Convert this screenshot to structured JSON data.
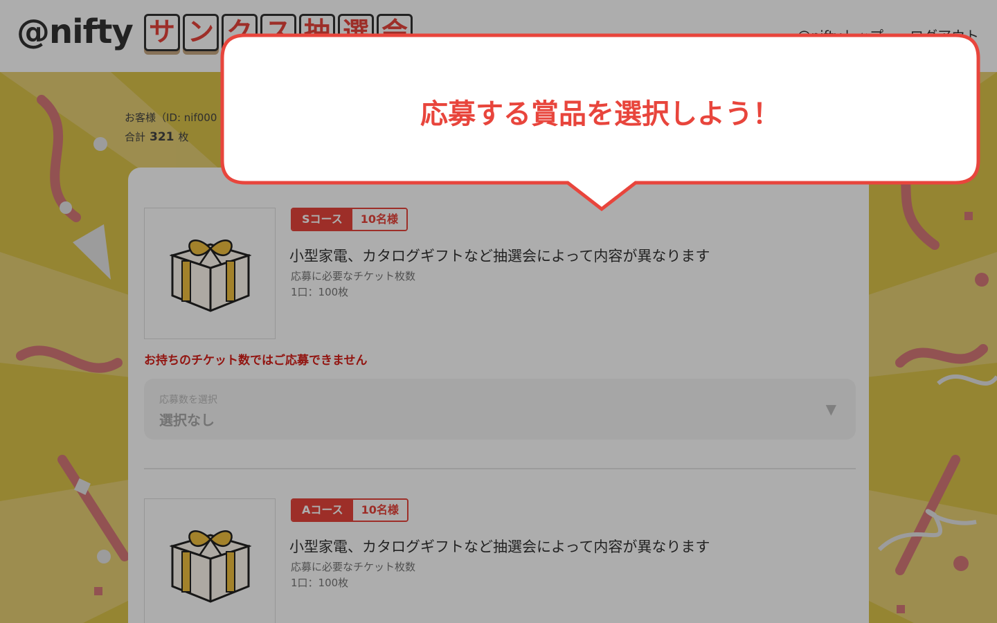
{
  "header": {
    "logo_text": "@nifty",
    "logo_tiles": [
      "サ",
      "ン",
      "ク",
      "ス",
      "抽",
      "選",
      "会"
    ],
    "links": [
      "@niftyトップ",
      "ログアウト"
    ]
  },
  "user": {
    "customer_label": "お客様（ID: nif000",
    "total_label": "合計",
    "total_count": "321",
    "total_unit": "枚"
  },
  "prizes": [
    {
      "course": "Sコース",
      "winners": "10名様",
      "description": "小型家電、カタログギフトなど抽選会によって内容が異なります",
      "req_label": "応募に必要なチケット枚数",
      "req_value": "1口：100枚"
    },
    {
      "course": "Aコース",
      "winners": "10名様",
      "description": "小型家電、カタログギフトなど抽選会によって内容が異なります",
      "req_label": "応募に必要なチケット枚数",
      "req_value": "1口：100枚"
    }
  ],
  "error_message": "お持ちのチケット数ではご応募できません",
  "select": {
    "label": "応募数を選択",
    "value": "選択なし",
    "arrow": "▼"
  },
  "tooltip": {
    "text": "応募する賞品を選択しよう！"
  },
  "colors": {
    "accent": "#e8453c",
    "background": "#dcc44a",
    "error": "#d8201a"
  }
}
